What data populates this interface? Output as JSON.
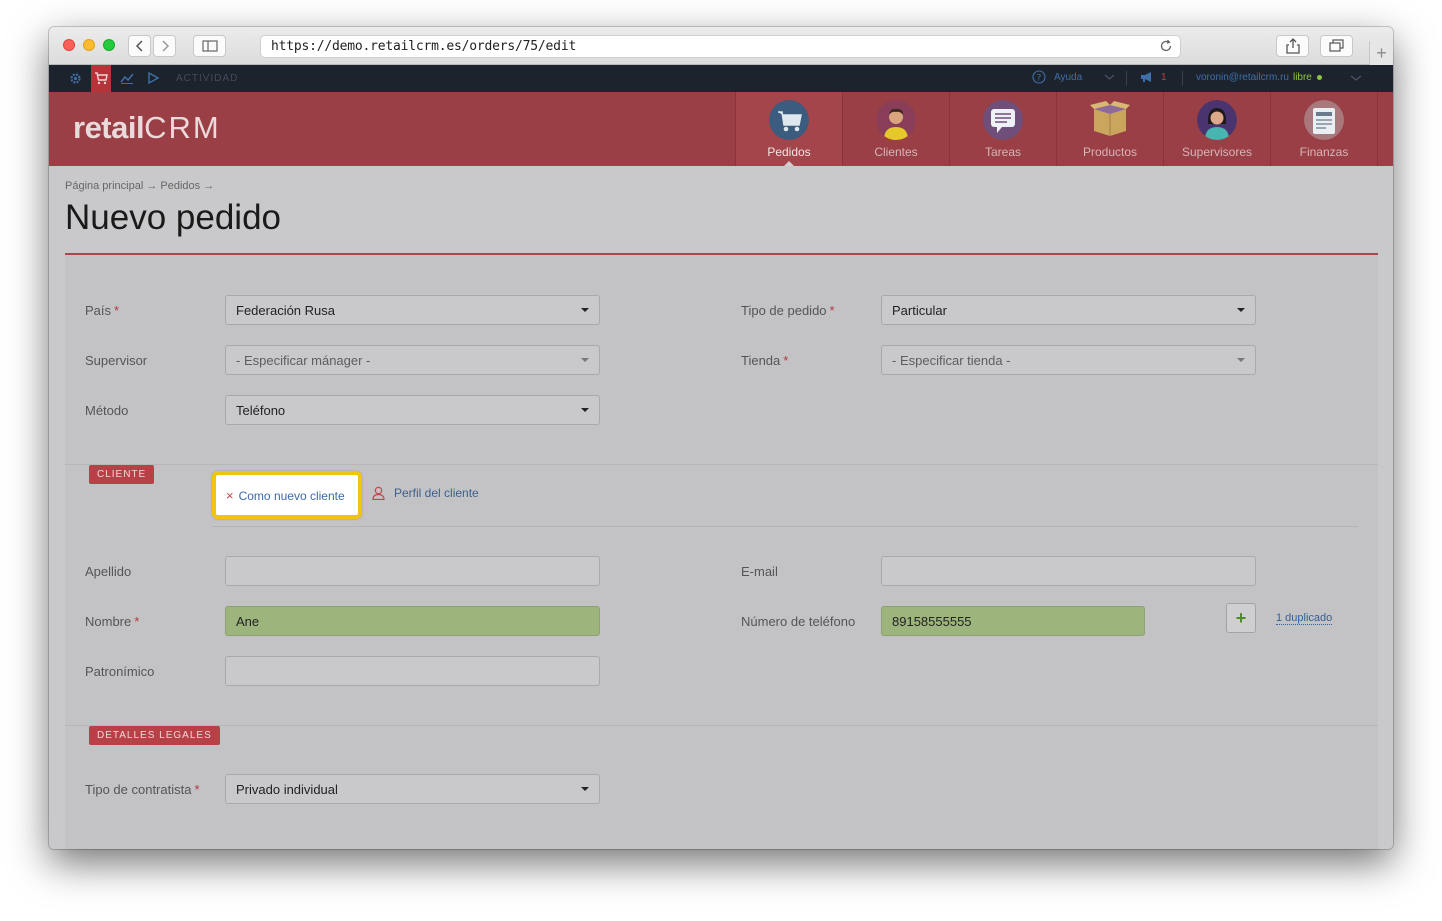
{
  "browser": {
    "url": "https://demo.retailcrm.es/orders/75/edit"
  },
  "topbar": {
    "activity_label": "ACTIVIDAD",
    "help_label": "Ayuda",
    "notifications_count": "1",
    "user_email": "voronin@retailcrm.ru",
    "user_status": "libre",
    "status_color": "#8cc63f"
  },
  "header": {
    "logo_retail": "retail",
    "logo_crm": "CRM",
    "brand_color": "#9a3f45",
    "nav": [
      {
        "label": "Pedidos",
        "icon": "cart-icon"
      },
      {
        "label": "Clientes",
        "icon": "customer-avatar-icon"
      },
      {
        "label": "Tareas",
        "icon": "tasks-chat-icon"
      },
      {
        "label": "Productos",
        "icon": "box-icon"
      },
      {
        "label": "Supervisores",
        "icon": "manager-avatar-icon"
      },
      {
        "label": "Finanzas",
        "icon": "finance-doc-icon"
      }
    ]
  },
  "page": {
    "breadcrumb": "Página principal → Pedidos →",
    "title": "Nuevo pedido"
  },
  "form": {
    "pais": {
      "label": "País",
      "value": "Federación Rusa"
    },
    "tipo_pedido": {
      "label": "Tipo de pedido",
      "value": "Particular"
    },
    "supervisor": {
      "label": "Supervisor",
      "value": "- Especificar mánager -"
    },
    "tienda": {
      "label": "Tienda",
      "value": "- Especificar tienda -"
    },
    "metodo": {
      "label": "Método",
      "value": "Teléfono"
    }
  },
  "cliente": {
    "section_label": "CLIENTE",
    "new_client_link": "Como nuevo cliente",
    "profile_link": "Perfil del cliente",
    "apellido": {
      "label": "Apellido",
      "value": ""
    },
    "email": {
      "label": "E-mail",
      "value": ""
    },
    "nombre": {
      "label": "Nombre",
      "value": "Ane"
    },
    "telefono": {
      "label": "Número de teléfono",
      "value": "89158555555"
    },
    "duplicate_link": "1 duplicado",
    "plus_label": "+",
    "patronimico": {
      "label": "Patronímico",
      "value": ""
    }
  },
  "legal": {
    "section_label": "DETALLES LEGALES",
    "contratista": {
      "label": "Tipo de contratista",
      "value": "Privado individual"
    }
  }
}
